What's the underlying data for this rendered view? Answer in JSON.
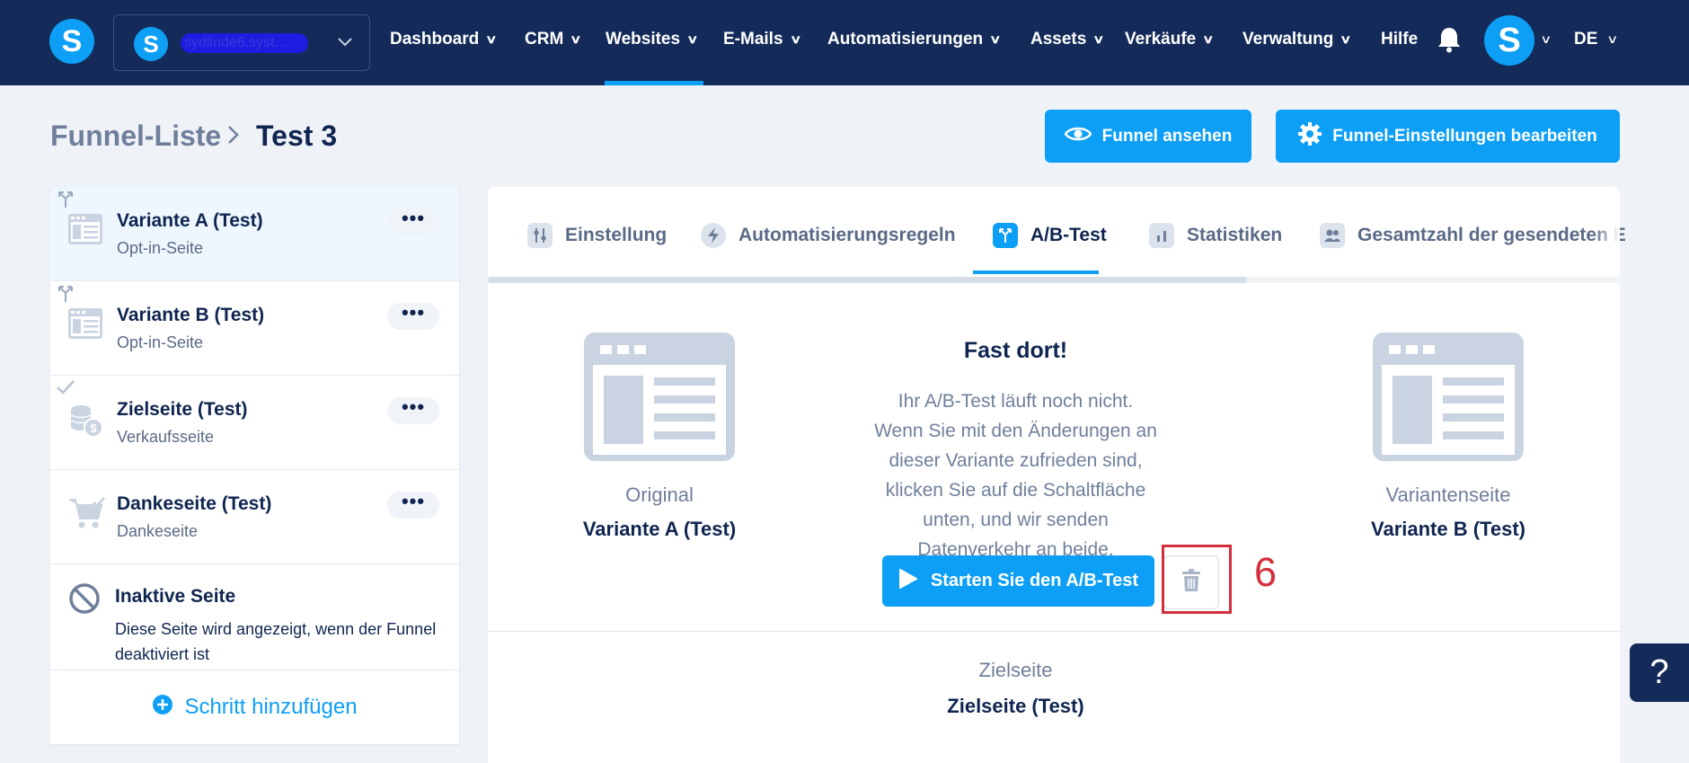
{
  "nav": {
    "account_name": "sydlinde6.syst...",
    "items": [
      "Dashboard",
      "CRM",
      "Websites",
      "E-Mails",
      "Automatisierungen",
      "Assets",
      "Verkäufe",
      "Verwaltung"
    ],
    "help": "Hilfe",
    "avatar_letter": "S",
    "logo_letter": "S",
    "language": "DE"
  },
  "breadcrumb": {
    "parent": "Funnel-Liste",
    "current": "Test 3"
  },
  "actions": {
    "view_funnel": "Funnel ansehen",
    "edit_settings": "Funnel-Einstellungen bearbeiten"
  },
  "steps": [
    {
      "title": "Variante A (Test)",
      "subtitle": "Opt-in-Seite",
      "more": "•••"
    },
    {
      "title": "Variante B (Test)",
      "subtitle": "Opt-in-Seite",
      "more": "•••"
    },
    {
      "title": "Zielseite (Test)",
      "subtitle": "Verkaufsseite",
      "more": "•••"
    },
    {
      "title": "Dankeseite (Test)",
      "subtitle": "Dankeseite",
      "more": "•••"
    }
  ],
  "inactive_page": {
    "title": "Inaktive Seite",
    "description": "Diese Seite wird angezeigt, wenn der Funnel deaktiviert ist"
  },
  "add_step": "Schritt hinzufügen",
  "tabs": [
    "Einstellung",
    "Automatisierungsregeln",
    "A/B-Test",
    "Statistiken",
    "Gesamtzahl der gesendeten E"
  ],
  "ab_test": {
    "heading": "Fast dort!",
    "message": "Ihr A/B-Test läuft noch nicht. Wenn Sie mit den Änderungen an dieser Variante zufrieden sind, klicken Sie auf die Schaltfläche unten, und wir senden Datenverkehr an beide.",
    "start_button": "Starten Sie den A/B-Test",
    "original_label": "Original",
    "original_value": "Variante A (Test)",
    "variant_label": "Variantenseite",
    "variant_value": "Variante B (Test)",
    "target_label": "Zielseite",
    "target_value": "Zielseite (Test)"
  },
  "annotation_number": "6",
  "help_button": "?",
  "colors": {
    "nav_bg": "#142b59",
    "accent": "#0d9ff5",
    "annotation": "#d42f3d"
  }
}
